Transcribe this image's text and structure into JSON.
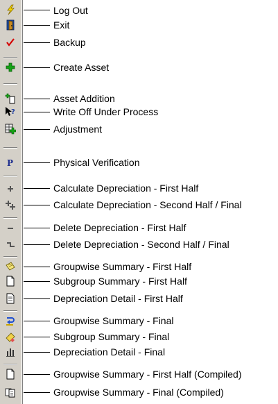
{
  "toolbar": {
    "items": [
      {
        "label": "Log Out",
        "icon": "lightning-icon"
      },
      {
        "label": "Exit",
        "icon": "door-exit-icon"
      },
      {
        "label": "Backup",
        "icon": "red-checkmark-icon"
      },
      {
        "label": "Create Asset",
        "icon": "green-plus-icon"
      },
      {
        "label": "Asset Addition",
        "icon": "document-plus-icon"
      },
      {
        "label": "Write Off Under Process",
        "icon": "pointer-question-icon"
      },
      {
        "label": "Adjustment",
        "icon": "grid-plus-icon"
      },
      {
        "label": "Physical Verification",
        "icon": "letter-p-icon"
      },
      {
        "label": "Calculate Depreciation - First Half",
        "icon": "single-plus-icon"
      },
      {
        "label": "Calculate Depreciation - Second Half / Final",
        "icon": "double-plus-icon"
      },
      {
        "label": "Delete Depreciation - First Half",
        "icon": "single-minus-icon"
      },
      {
        "label": "Delete Depreciation - Second Half / Final",
        "icon": "double-minus-icon"
      },
      {
        "label": "Groupwise Summary - First Half",
        "icon": "notepad-icon"
      },
      {
        "label": "Subgroup Summary - First Half",
        "icon": "blank-page-icon"
      },
      {
        "label": "Depreciation Detail - First Half",
        "icon": "text-page-icon"
      },
      {
        "label": "Groupwise Summary - Final",
        "icon": "blue-arrow-icon"
      },
      {
        "label": "Subgroup Summary - Final",
        "icon": "eraser-icon"
      },
      {
        "label": "Depreciation Detail - Final",
        "icon": "bar-chart-icon"
      },
      {
        "label": "Groupwise Summary - First Half (Compiled)",
        "icon": "blank-page-icon"
      },
      {
        "label": "Groupwise Summary - Final (Compiled)",
        "icon": "stacked-pages-icon"
      }
    ]
  }
}
